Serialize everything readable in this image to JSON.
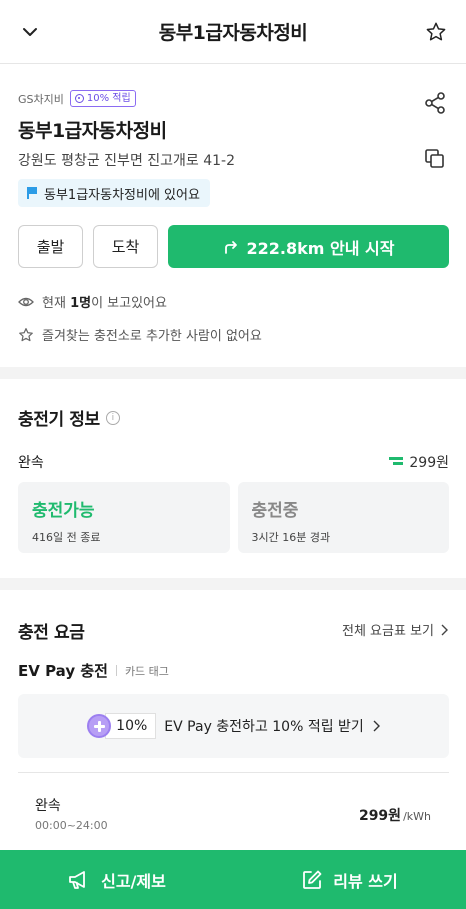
{
  "header": {
    "title": "동부1급자동차정비",
    "back_icon": "chevron-down-icon",
    "favorite_icon": "star-icon"
  },
  "station": {
    "brand": "GS차지비",
    "badge": "10% 적립",
    "name": "동부1급자동차정비",
    "address": "강원도 평창군 진부면 진고개로 41-2",
    "location_tag": "동부1급자동차정비에 있어요"
  },
  "actions": {
    "depart_label": "출발",
    "arrive_label": "도착",
    "navigate_label": "222.8km 안내 시작"
  },
  "stats": {
    "viewing_prefix": "현재 ",
    "viewing_count": "1명",
    "viewing_suffix": "이 보고있어요",
    "favorites_text": "즐겨찾는 충전소로 추가한 사람이 없어요"
  },
  "charger_info": {
    "title": "충전기 정보",
    "speed": "완속",
    "price": "299원",
    "cards": [
      {
        "state": "충전가능",
        "detail": "416일 전 종료"
      },
      {
        "state": "충전중",
        "detail": "3시간 16분 경과"
      }
    ]
  },
  "fees": {
    "title": "충전 요금",
    "view_all": "전체 요금표 보기",
    "evpay_title": "EV Pay 충전",
    "evpay_sub": "카드 태그",
    "promo_percent": "10%",
    "promo_text": "EV Pay 충전하고 10% 적립 받기",
    "rate_name": "완속",
    "rate_time": "00:00~24:00",
    "rate_price": "299원",
    "rate_unit": "/kWh"
  },
  "bottom": {
    "report_label": "신고/제보",
    "review_label": "리뷰 쓰기"
  },
  "colors": {
    "accent_green": "#1fba6e",
    "badge_purple": "#6b4de6"
  }
}
